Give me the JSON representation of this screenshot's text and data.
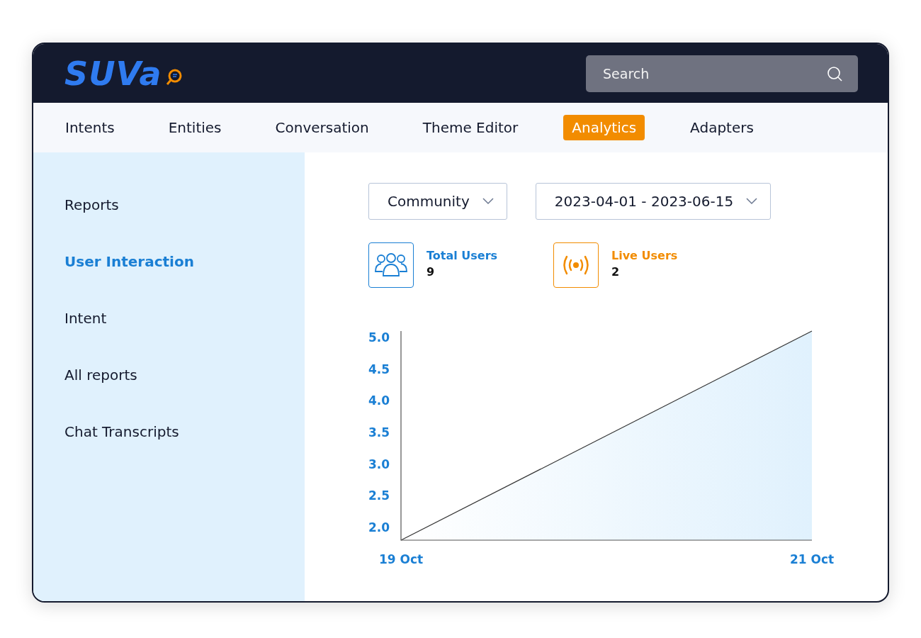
{
  "logo": {
    "text": "SUVa"
  },
  "search": {
    "placeholder": "Search"
  },
  "tabs": [
    {
      "label": "Intents",
      "selected": false
    },
    {
      "label": "Entities",
      "selected": false
    },
    {
      "label": "Conversation",
      "selected": false
    },
    {
      "label": "Theme Editor",
      "selected": false
    },
    {
      "label": "Analytics",
      "selected": true
    },
    {
      "label": "Adapters",
      "selected": false
    }
  ],
  "sidebar": {
    "items": [
      {
        "label": "Reports",
        "selected": false
      },
      {
        "label": "User Interaction",
        "selected": true
      },
      {
        "label": "Intent",
        "selected": false
      },
      {
        "label": "All reports",
        "selected": false
      },
      {
        "label": "Chat Transcripts",
        "selected": false
      }
    ]
  },
  "filters": [
    {
      "value": "Community"
    },
    {
      "value": "2023-04-01 - 2023-06-15"
    }
  ],
  "stats": [
    {
      "kind": "users",
      "label": "Total Users",
      "value": "9",
      "color": "#1a7fd4"
    },
    {
      "kind": "live",
      "label": "Live Users",
      "value": "2",
      "color": "#f28c00"
    }
  ],
  "chart": {
    "chart_data": {
      "type": "area",
      "categories": [
        "19 Oct",
        "21 Oct"
      ],
      "series": [
        {
          "color": "#333333",
          "values": [
            1.8,
            5.1
          ]
        }
      ],
      "ylim": [
        1.8,
        5.1
      ],
      "yticks": [
        {
          "value": 2,
          "label": "2.0"
        },
        2.5,
        {
          "value": 3,
          "label": "3.0"
        },
        3.5,
        {
          "value": 4,
          "label": "4.0"
        },
        4.5,
        {
          "value": 5,
          "label": "5.0"
        }
      ]
    }
  }
}
